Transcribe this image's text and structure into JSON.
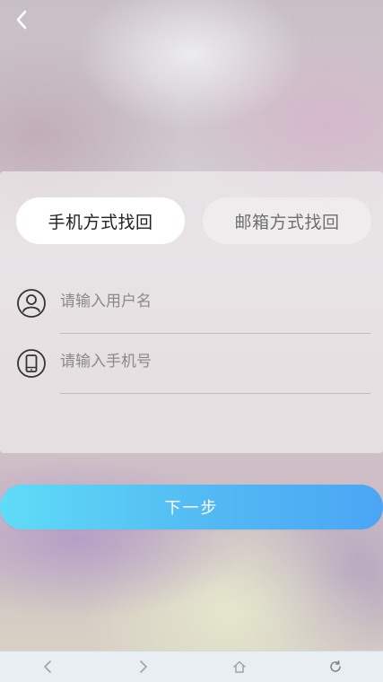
{
  "header": {
    "back_icon": "chevron-left-icon"
  },
  "tabs": [
    {
      "label": "手机方式找回",
      "active": true
    },
    {
      "label": "邮箱方式找回",
      "active": false
    }
  ],
  "form": {
    "username": {
      "placeholder": "请输入用户名",
      "value": "",
      "icon": "user-icon"
    },
    "phone": {
      "placeholder": "请输入手机号",
      "value": "",
      "icon": "mobile-phone-icon"
    }
  },
  "next_button": {
    "label": "下一步"
  },
  "browser_nav": {
    "icons": [
      "back-arrow-icon",
      "forward-arrow-icon",
      "home-icon",
      "refresh-icon"
    ]
  },
  "colors": {
    "button_gradient_start": "#5fdcf7",
    "button_gradient_end": "#4aa6f5",
    "tab_active_bg": "#ffffff",
    "text_dark": "#222222",
    "placeholder": "#8a8a8a"
  }
}
